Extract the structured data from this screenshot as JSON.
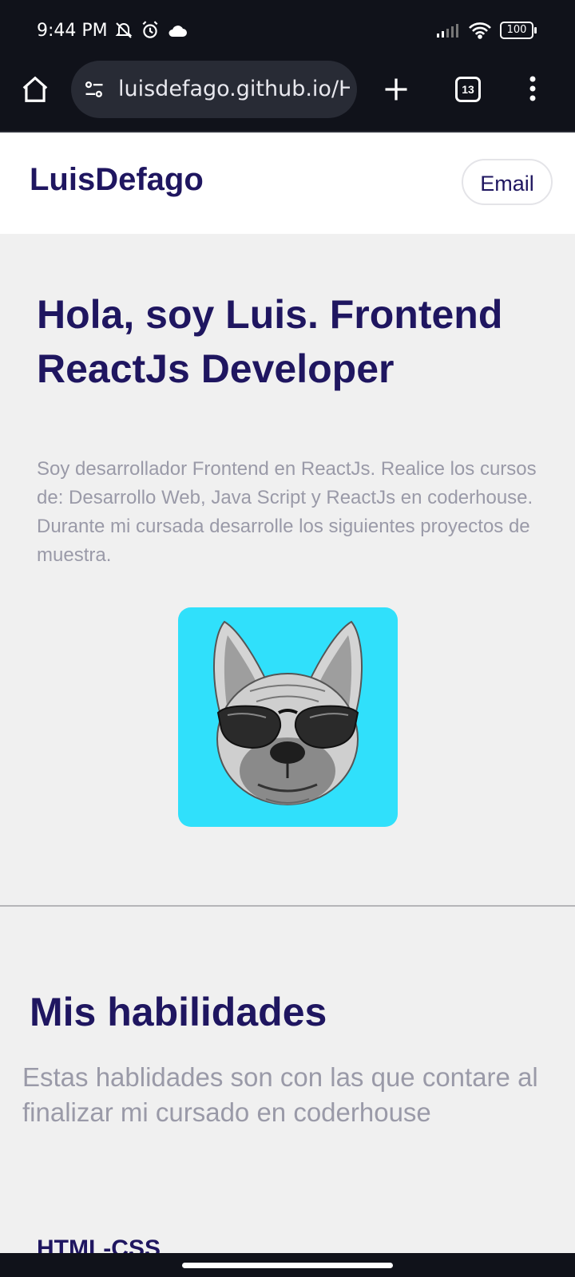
{
  "status_bar": {
    "time": "9:44 PM",
    "icons_left": [
      "mute-bell-icon",
      "alarm-icon",
      "cloud-icon"
    ],
    "icons_right": [
      "signal-icon",
      "wifi-icon",
      "battery-icon"
    ],
    "battery": "100"
  },
  "browser": {
    "url": "luisdefago.github.io/H",
    "tab_count": "13",
    "icons": [
      "home-icon",
      "site-settings-icon",
      "new-tab-icon",
      "tabs-icon",
      "menu-icon"
    ]
  },
  "header": {
    "logo": "LuisDefago",
    "email_button": "Email"
  },
  "hero": {
    "title": "Hola, soy Luis. Frontend ReactJs Developer",
    "description": "Soy desarrollador Frontend en ReactJs. Realice los cursos de: Desarrollo Web, Java Script y ReactJs en coderhouse. Durante mi cursada desarrolle los siguientes proyectos de muestra.",
    "avatar_bg": "#30e0fb"
  },
  "skills": {
    "title": "Mis habilidades",
    "description": "Estas hablidades son con las que contare al finalizar mi cursado en coderhouse",
    "first_item": "HTML-CSS"
  },
  "colors": {
    "brand": "#1f1660",
    "muted_text": "#9a9aa8",
    "page_bg": "#f0f0f0",
    "bar_bg": "#10121a"
  }
}
